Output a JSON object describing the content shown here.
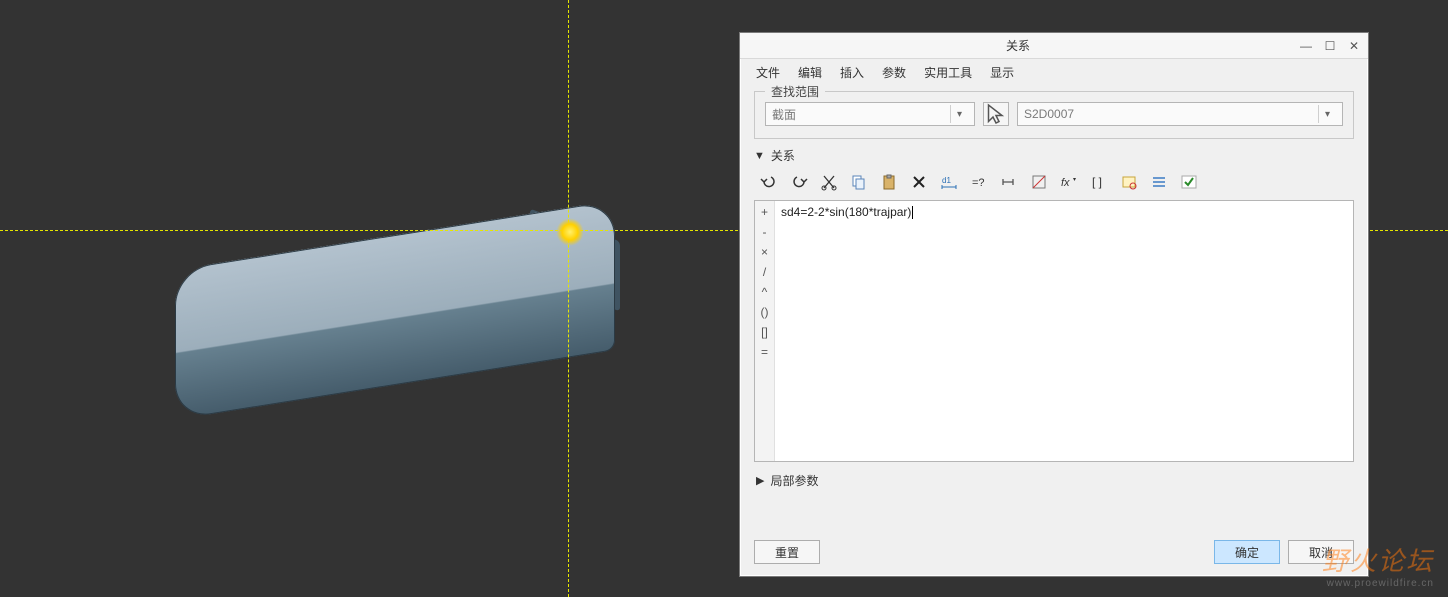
{
  "dialog": {
    "title": "关系",
    "menu": [
      "文件",
      "编辑",
      "插入",
      "参数",
      "实用工具",
      "显示"
    ],
    "scope": {
      "legend": "查找范围",
      "combo1_value": "截面",
      "combo2_value": "S2D0007"
    },
    "rel_section_label": "关系",
    "toolbar_icons": [
      "undo-icon",
      "redo-icon",
      "cut-icon",
      "copy-icon",
      "paste-icon",
      "delete-icon",
      "dimension-icon",
      "evaluate-icon",
      "goto-icon",
      "units-icon",
      "fx-icon",
      "brackets-icon",
      "highlight-icon",
      "sort-icon",
      "check-icon"
    ],
    "gutter_symbols": [
      "+",
      "-",
      "×",
      "/",
      "^",
      "()",
      "[]",
      "="
    ],
    "editor_text": "sd4=2-2*sin(180*trajpar)",
    "local_params_label": "局部参数",
    "buttons": {
      "reset": "重置",
      "ok": "确定",
      "cancel": "取消"
    }
  },
  "watermark": {
    "main": "野火论坛",
    "sub": "www.proewildfire.cn"
  }
}
